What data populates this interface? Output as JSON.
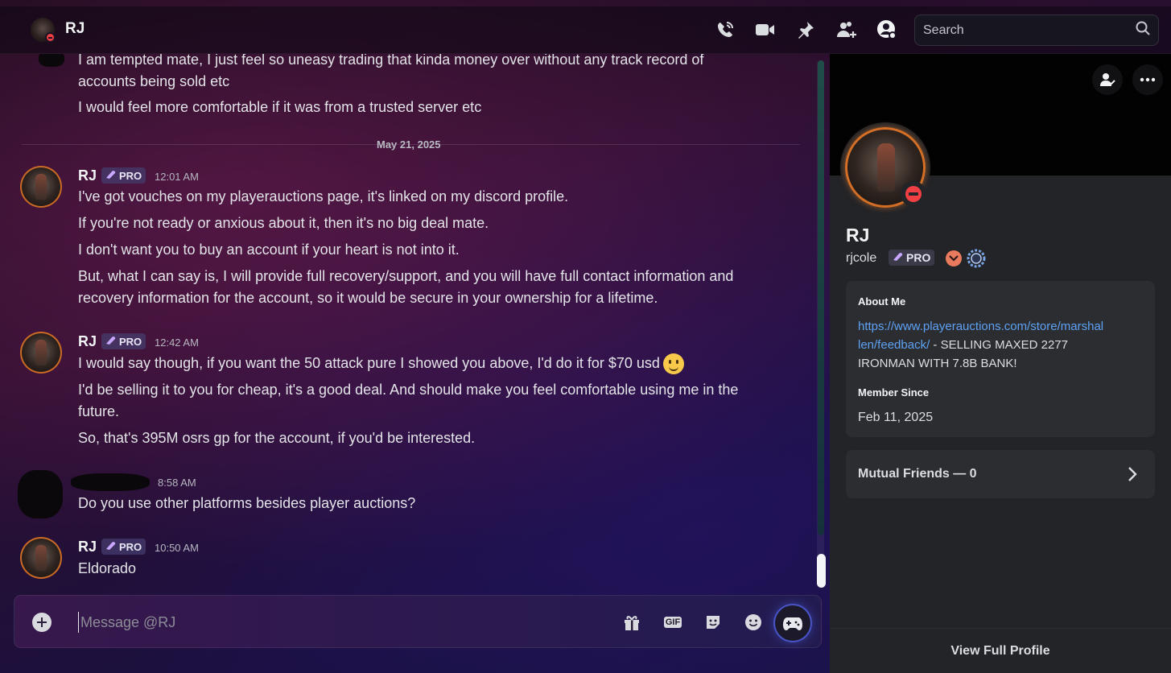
{
  "header": {
    "title": "RJ",
    "search_placeholder": "Search",
    "icons": [
      "phone-call-icon",
      "video-icon",
      "pin-icon",
      "add-friend-icon",
      "user-profile-icon",
      "search-icon"
    ]
  },
  "chat": {
    "prev_lines": [
      "I am tempted mate, I just feel so uneasy trading that kinda money over without any track record of",
      "accounts being sold etc",
      "I would feel more comfortable if it was from a trusted server etc"
    ],
    "date_divider": "May 21, 2025",
    "messages": [
      {
        "author": "RJ",
        "badge": "PRO",
        "time": "12:01 AM",
        "lines": [
          "I've got vouches on my playerauctions page, it's linked on my discord profile.",
          "If you're not ready or anxious about it, then it's no big deal mate.",
          "I don't want you to buy an account if your heart is not into it.",
          "But, what I can say is, I will provide full recovery/support, and you will have full contact information and",
          "recovery information for the account, so it would be secure in your ownership for a lifetime."
        ]
      },
      {
        "author": "RJ",
        "badge": "PRO",
        "time": "12:42 AM",
        "lines": [
          "I would say though, if you want the 50 attack pure I showed you above, I'd do it for $70 usd",
          "I'd be selling it to you for cheap, it's a good deal. And should make you feel comfortable using me in the",
          "future.",
          "So, that's 395M osrs gp for the account, if you'd be interested."
        ]
      },
      {
        "author": "",
        "time": "8:58 AM",
        "lines": [
          "Do you use other platforms besides player auctions?"
        ]
      },
      {
        "author": "RJ",
        "badge": "PRO",
        "time": "10:50 AM",
        "lines": [
          "Eldorado"
        ]
      }
    ]
  },
  "composer": {
    "placeholder": "Message @RJ",
    "gif_label": "GIF"
  },
  "profile": {
    "display_name": "RJ",
    "username": "rjcole",
    "badge": "PRO",
    "about_title": "About Me",
    "about_link": "https://www.playerauctions.com/store/marshallen/feedback/",
    "about_link_line1": "https://www.playerauctions.com/store/marshal",
    "about_link_line2": "len/feedback/",
    "about_rest_line1": " - SELLING MAXED 2277",
    "about_rest_line2": "IRONMAN WITH 7.8B BANK!",
    "member_since_title": "Member Since",
    "member_since": "Feb 11, 2025",
    "mutual_friends": "Mutual Friends — 0",
    "view_full": "View Full Profile"
  },
  "colors": {
    "accent_link": "#5ea1f5",
    "status_dnd": "#f23f43",
    "panel_bg": "#232428",
    "card_bg": "#2b2d31"
  }
}
